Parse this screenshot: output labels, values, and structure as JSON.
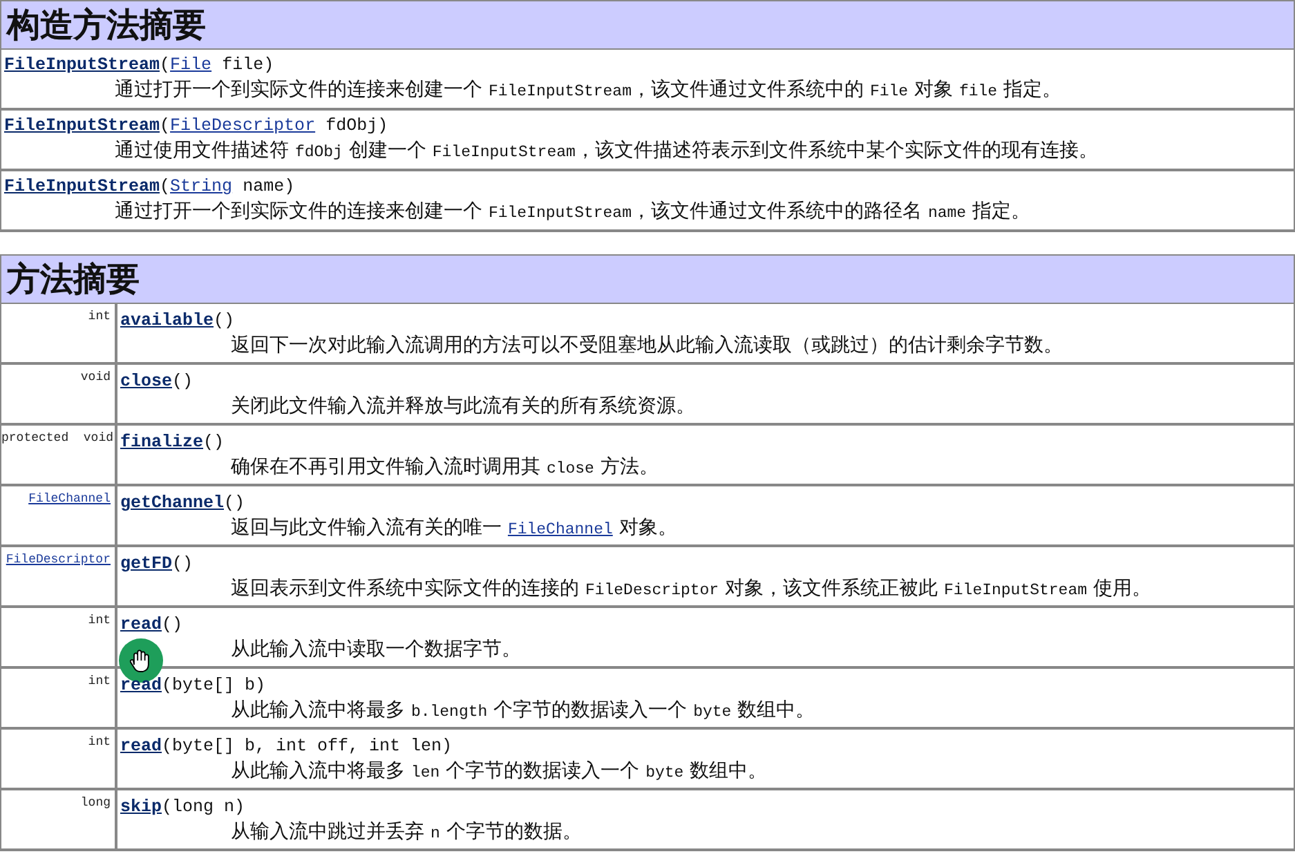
{
  "constructor_summary": {
    "title": "构造方法摘要",
    "rows": [
      {
        "signature": [
          {
            "kind": "member",
            "text": "FileInputStream"
          },
          {
            "kind": "plain",
            "text": "("
          },
          {
            "kind": "link",
            "text": "File"
          },
          {
            "kind": "plain",
            "text": " file)"
          }
        ],
        "description": [
          {
            "kind": "text",
            "text": "通过打开一个到实际文件的连接来创建一个 "
          },
          {
            "kind": "code",
            "text": "FileInputStream"
          },
          {
            "kind": "text",
            "text": "，该文件通过文件系统中的 "
          },
          {
            "kind": "code",
            "text": "File"
          },
          {
            "kind": "text",
            "text": " 对象 "
          },
          {
            "kind": "code",
            "text": "file"
          },
          {
            "kind": "text",
            "text": " 指定。"
          }
        ]
      },
      {
        "signature": [
          {
            "kind": "member",
            "text": "FileInputStream"
          },
          {
            "kind": "plain",
            "text": "("
          },
          {
            "kind": "link",
            "text": "FileDescriptor"
          },
          {
            "kind": "plain",
            "text": " fdObj)"
          }
        ],
        "description": [
          {
            "kind": "text",
            "text": "通过使用文件描述符 "
          },
          {
            "kind": "code",
            "text": "fdObj"
          },
          {
            "kind": "text",
            "text": " 创建一个 "
          },
          {
            "kind": "code",
            "text": "FileInputStream"
          },
          {
            "kind": "text",
            "text": "，该文件描述符表示到文件系统中某个实际文件的现有连接。"
          }
        ]
      },
      {
        "signature": [
          {
            "kind": "member",
            "text": "FileInputStream"
          },
          {
            "kind": "plain",
            "text": "("
          },
          {
            "kind": "link",
            "text": "String"
          },
          {
            "kind": "plain",
            "text": " name)"
          }
        ],
        "description": [
          {
            "kind": "text",
            "text": "通过打开一个到实际文件的连接来创建一个 "
          },
          {
            "kind": "code",
            "text": "FileInputStream"
          },
          {
            "kind": "text",
            "text": "，该文件通过文件系统中的路径名 "
          },
          {
            "kind": "code",
            "text": "name"
          },
          {
            "kind": "text",
            "text": " 指定。"
          }
        ]
      }
    ]
  },
  "method_summary": {
    "title": "方法摘要",
    "rows": [
      {
        "return_type": {
          "kind": "plain",
          "text": "int"
        },
        "signature": [
          {
            "kind": "member",
            "text": "available"
          },
          {
            "kind": "plain",
            "text": "()"
          }
        ],
        "description": [
          {
            "kind": "text",
            "text": "返回下一次对此输入流调用的方法可以不受阻塞地从此输入流读取（或跳过）的估计剩余字节数。"
          }
        ]
      },
      {
        "return_type": {
          "kind": "plain",
          "text": "void"
        },
        "signature": [
          {
            "kind": "member",
            "text": "close"
          },
          {
            "kind": "plain",
            "text": "()"
          }
        ],
        "description": [
          {
            "kind": "text",
            "text": "关闭此文件输入流并释放与此流有关的所有系统资源。"
          }
        ]
      },
      {
        "return_type": {
          "kind": "plain",
          "text": "protected  void"
        },
        "signature": [
          {
            "kind": "member",
            "text": "finalize"
          },
          {
            "kind": "plain",
            "text": "()"
          }
        ],
        "description": [
          {
            "kind": "text",
            "text": "确保在不再引用文件输入流时调用其 "
          },
          {
            "kind": "code",
            "text": "close"
          },
          {
            "kind": "text",
            "text": " 方法。"
          }
        ]
      },
      {
        "return_type": {
          "kind": "link",
          "text": "FileChannel"
        },
        "signature": [
          {
            "kind": "member",
            "text": "getChannel"
          },
          {
            "kind": "plain",
            "text": "()"
          }
        ],
        "description": [
          {
            "kind": "text",
            "text": "返回与此文件输入流有关的唯一 "
          },
          {
            "kind": "link",
            "text": "FileChannel"
          },
          {
            "kind": "text",
            "text": " 对象。"
          }
        ]
      },
      {
        "return_type": {
          "kind": "link",
          "text": "FileDescriptor"
        },
        "signature": [
          {
            "kind": "member",
            "text": "getFD"
          },
          {
            "kind": "plain",
            "text": "()"
          }
        ],
        "description": [
          {
            "kind": "text",
            "text": "返回表示到文件系统中实际文件的连接的 "
          },
          {
            "kind": "code",
            "text": "FileDescriptor"
          },
          {
            "kind": "text",
            "text": " 对象，该文件系统正被此 "
          },
          {
            "kind": "code",
            "text": "FileInputStream"
          },
          {
            "kind": "text",
            "text": " 使用。"
          }
        ]
      },
      {
        "return_type": {
          "kind": "plain",
          "text": "int"
        },
        "signature": [
          {
            "kind": "member",
            "text": "read"
          },
          {
            "kind": "plain",
            "text": "()"
          }
        ],
        "description": [
          {
            "kind": "text",
            "text": "从此输入流中读取一个数据字节。"
          }
        ]
      },
      {
        "return_type": {
          "kind": "plain",
          "text": "int"
        },
        "signature": [
          {
            "kind": "member",
            "text": "read"
          },
          {
            "kind": "plain",
            "text": "(byte[] b)"
          }
        ],
        "description": [
          {
            "kind": "text",
            "text": "从此输入流中将最多 "
          },
          {
            "kind": "code",
            "text": "b.length"
          },
          {
            "kind": "text",
            "text": " 个字节的数据读入一个 "
          },
          {
            "kind": "code",
            "text": "byte"
          },
          {
            "kind": "text",
            "text": " 数组中。"
          }
        ]
      },
      {
        "return_type": {
          "kind": "plain",
          "text": "int"
        },
        "signature": [
          {
            "kind": "member",
            "text": "read"
          },
          {
            "kind": "plain",
            "text": "(byte[] b, int off, int len)"
          }
        ],
        "description": [
          {
            "kind": "text",
            "text": "从此输入流中将最多 "
          },
          {
            "kind": "code",
            "text": "len"
          },
          {
            "kind": "text",
            "text": " 个字节的数据读入一个 "
          },
          {
            "kind": "code",
            "text": "byte"
          },
          {
            "kind": "text",
            "text": " 数组中。"
          }
        ]
      },
      {
        "return_type": {
          "kind": "plain",
          "text": "long"
        },
        "signature": [
          {
            "kind": "member",
            "text": "skip"
          },
          {
            "kind": "plain",
            "text": "(long n)"
          }
        ],
        "description": [
          {
            "kind": "text",
            "text": "从输入流中跳过并丢弃 "
          },
          {
            "kind": "code",
            "text": "n"
          },
          {
            "kind": "text",
            "text": " 个字节的数据。"
          }
        ]
      }
    ]
  }
}
